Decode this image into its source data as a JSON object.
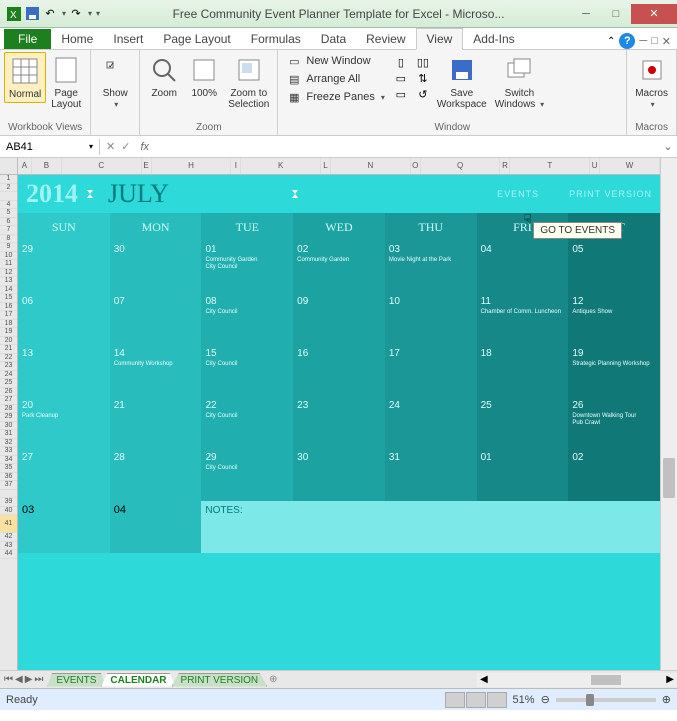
{
  "title": "Free Community Event Planner Template for Excel - Microso...",
  "tabs": {
    "file": "File",
    "items": [
      "Home",
      "Insert",
      "Page Layout",
      "Formulas",
      "Data",
      "Review",
      "View",
      "Add-Ins"
    ],
    "active": "View"
  },
  "ribbon": {
    "groups": {
      "workbook_views": {
        "label": "Workbook Views",
        "normal": "Normal",
        "page_layout": "Page\nLayout"
      },
      "show": {
        "label": "",
        "show": "Show"
      },
      "zoom": {
        "label": "Zoom",
        "zoom": "Zoom",
        "hundred": "100%",
        "to_sel": "Zoom to\nSelection"
      },
      "window": {
        "label": "Window",
        "new_window": "New Window",
        "arrange": "Arrange All",
        "freeze": "Freeze Panes",
        "save_ws": "Save\nWorkspace",
        "switch": "Switch\nWindows"
      },
      "macros": {
        "label": "Macros",
        "macros": "Macros"
      }
    }
  },
  "namebox": "AB41",
  "fx": "fx",
  "col_letters": [
    "A",
    "B",
    "C",
    "E",
    "H",
    "I",
    "K",
    "L",
    "N",
    "O",
    "Q",
    "R",
    "T",
    "U",
    "W"
  ],
  "calendar": {
    "year": "2014",
    "month": "JULY",
    "links": {
      "events": "EVENTS",
      "print": "PRINT VERSION"
    },
    "days": [
      "SUN",
      "MON",
      "TUE",
      "WED",
      "THU",
      "FRI",
      "SAT"
    ],
    "tooltip": "GO TO EVENTS",
    "notes_label": "NOTES:",
    "weeks": [
      [
        {
          "n": "29",
          "ev": []
        },
        {
          "n": "30",
          "ev": []
        },
        {
          "n": "01",
          "ev": [
            "Community Garden",
            "City Council"
          ]
        },
        {
          "n": "02",
          "ev": [
            "Community Garden"
          ]
        },
        {
          "n": "03",
          "ev": [
            "Movie Night at the Park"
          ]
        },
        {
          "n": "04",
          "ev": []
        },
        {
          "n": "05",
          "ev": []
        }
      ],
      [
        {
          "n": "06",
          "ev": []
        },
        {
          "n": "07",
          "ev": []
        },
        {
          "n": "08",
          "ev": [
            "City Council"
          ]
        },
        {
          "n": "09",
          "ev": []
        },
        {
          "n": "10",
          "ev": []
        },
        {
          "n": "11",
          "ev": [
            "Chamber of Comm. Luncheon"
          ]
        },
        {
          "n": "12",
          "ev": [
            "Antiques Show"
          ]
        }
      ],
      [
        {
          "n": "13",
          "ev": []
        },
        {
          "n": "14",
          "ev": [
            "Community Workshop"
          ]
        },
        {
          "n": "15",
          "ev": [
            "City Council"
          ]
        },
        {
          "n": "16",
          "ev": []
        },
        {
          "n": "17",
          "ev": []
        },
        {
          "n": "18",
          "ev": []
        },
        {
          "n": "19",
          "ev": [
            "Strategic Planning Workshop"
          ]
        }
      ],
      [
        {
          "n": "20",
          "ev": [
            "Park Cleanup"
          ]
        },
        {
          "n": "21",
          "ev": []
        },
        {
          "n": "22",
          "ev": [
            "City Council"
          ]
        },
        {
          "n": "23",
          "ev": []
        },
        {
          "n": "24",
          "ev": []
        },
        {
          "n": "25",
          "ev": []
        },
        {
          "n": "26",
          "ev": [
            "Downtown Walking Tour",
            "Pub Crawl"
          ]
        }
      ],
      [
        {
          "n": "27",
          "ev": []
        },
        {
          "n": "28",
          "ev": []
        },
        {
          "n": "29",
          "ev": [
            "City Council"
          ]
        },
        {
          "n": "30",
          "ev": []
        },
        {
          "n": "31",
          "ev": []
        },
        {
          "n": "01",
          "ev": []
        },
        {
          "n": "02",
          "ev": []
        }
      ]
    ],
    "extra_row": [
      {
        "n": "03"
      },
      {
        "n": "04"
      }
    ]
  },
  "sheet_tabs": [
    "EVENTS",
    "CALENDAR",
    "PRINT VERSION"
  ],
  "sheet_active": "CALENDAR",
  "status": {
    "ready": "Ready",
    "zoom": "51%"
  }
}
